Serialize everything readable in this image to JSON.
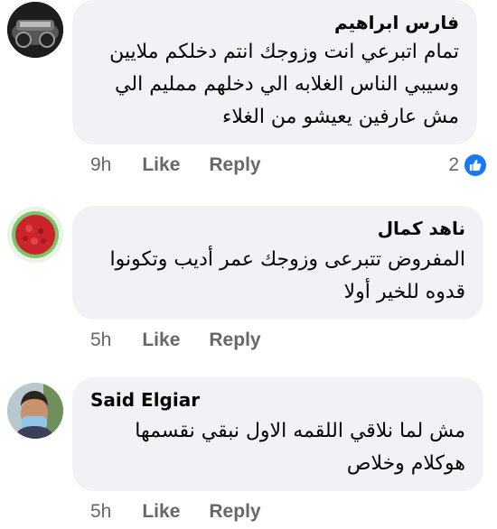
{
  "comments": [
    {
      "author": "فارس ابراهيم",
      "text": "تمام اتبرعي انت وزوجك انتم دخلكم ملايين وسيبي الناس الغلابه الي دخلهم ممليم الي مش عارفين يعيشو من الغلاء",
      "time": "9h",
      "like_label": "Like",
      "reply_label": "Reply",
      "reaction_count": "2",
      "reaction_icon": "like-reaction-icon"
    },
    {
      "author": "ناهد كمال",
      "text": "المفروض تتبرعى وزوجك عمر أديب وتكونوا قدوه للخير أولا",
      "time": "5h",
      "like_label": "Like",
      "reply_label": "Reply"
    },
    {
      "author": "Said Elgiar",
      "text": "مش لما نلاقي اللقمه الاول نبقي نقسمها هوكلام وخلاص",
      "time": "5h",
      "like_label": "Like",
      "reply_label": "Reply"
    }
  ],
  "colors": {
    "bubble_bg": "#f0f2f5",
    "meta_text": "#65676b",
    "like_blue": "#1877f2"
  }
}
